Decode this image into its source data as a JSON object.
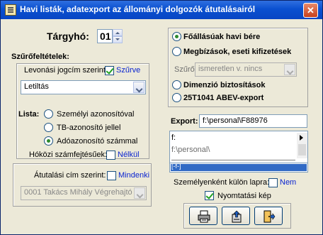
{
  "window": {
    "title": "Havi listák, adatexport az állományi dolgozók átutalásairól",
    "close_glyph": "✕"
  },
  "targyho": {
    "label": "Tárgyhó:",
    "value": "01"
  },
  "szurofeltetelek": {
    "label": "Szűrőfeltételek:",
    "levonasi_label": "Levonási jogcím szerint:",
    "levonasi_checked": true,
    "levonasi_state": "Szűrve",
    "jogcim_value": "Letiltás"
  },
  "lista": {
    "label": "Lista:",
    "options": [
      "Személyi azonosítóval",
      "TB-azonosító jellel",
      "Adóazonosító számmal"
    ],
    "selected_index": 2
  },
  "hokozi": {
    "label": "Hóközi számfejtésűek:",
    "state": "Nélkül",
    "checked": false
  },
  "atutalasi": {
    "label": "Átutalási cím szerint:",
    "state": "Mindenki",
    "checked": false,
    "value": "0001 Takács Mihály Végrehajtó I"
  },
  "tipus": {
    "options": [
      "Főállásúak havi bére",
      "Megbízások, eseti kifizetések"
    ],
    "selected_index": 0,
    "szuro_label": "Szűrő:",
    "szuro_value": "ismeretlen v. nincs",
    "extra_options": [
      "Dimenzió biztosítások",
      "25T1041 ABEV-export"
    ]
  },
  "export": {
    "label": "Export:",
    "path_value": "f:\\personal\\F88976",
    "tree_items": [
      "f:",
      "f:\\personal\\"
    ],
    "drive_value": "[-f-]"
  },
  "szemelyenkent": {
    "label": "Személyenként külön lapra:",
    "state": "Nem",
    "checked": false
  },
  "nyomtatasi": {
    "label": "Nyomtatási kép",
    "checked": true
  },
  "colors": {
    "accent": "#0a24d0",
    "selection": "#316ac5"
  }
}
